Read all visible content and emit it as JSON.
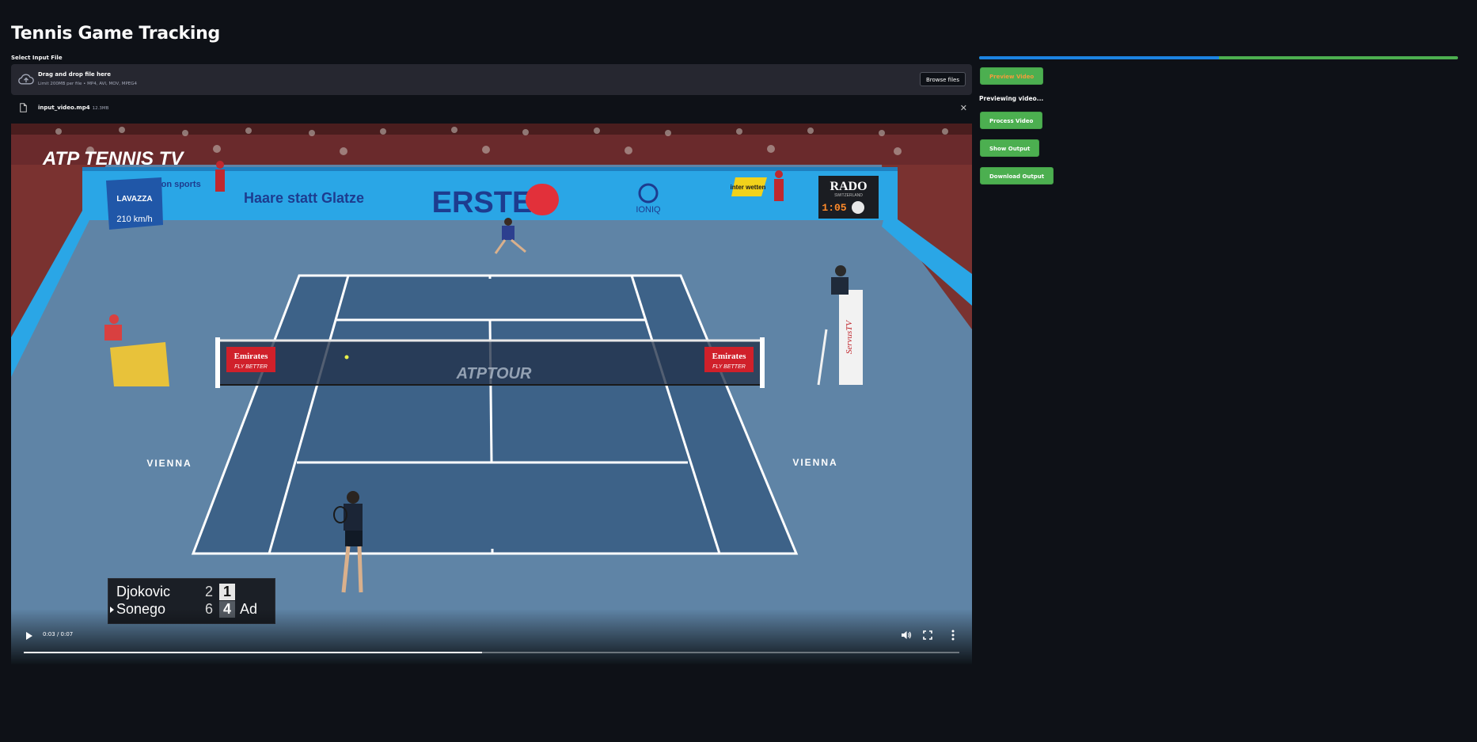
{
  "app": {
    "title": "Tennis Game Tracking"
  },
  "uploader": {
    "label": "Select Input File",
    "drop_text": "Drag and drop file here",
    "limit_text": "Limit 200MB per file • MP4, AVI, MOV, MPEG4",
    "browse_label": "Browse files",
    "file_name": "input_video.mp4",
    "file_size": "12.3MB",
    "close_glyph": "✕"
  },
  "video": {
    "time_display": "0:03 / 0:07",
    "played_fraction": 0.49,
    "overlay": {
      "broadcaster": "ATP TENNIS TV",
      "main_sponsor": "ERSTE",
      "sponsor_haare": "Haare statt Glatze",
      "sponsor_lavazza": "LAVAZZA",
      "lavazza_speed": "210 km/h",
      "sponsor_emotion": "emotion sports",
      "sponsor_ioniq": "IONIQ",
      "sponsor_interwetten": "inter wetten",
      "sponsor_rado": "RADO",
      "rado_sub": "SWITZERLAND",
      "clock": "1:05",
      "net_banner": "Emirates",
      "net_banner_sub": "FLY BETTER",
      "net_logo": "ATPTOUR",
      "city_left": "VIENNA",
      "city_right": "VIENNA",
      "umpire_board": "ServusTV"
    },
    "scoreboard": {
      "players": [
        {
          "name": "Djokovic",
          "set": "2",
          "game": "1",
          "points": ""
        },
        {
          "name": "Sonego",
          "set": "6",
          "game": "4",
          "points": "Ad"
        }
      ]
    },
    "colors": {
      "court": "#3d6288",
      "surround": "#5f84a6",
      "wall": "#2aa6e6"
    }
  },
  "sidebar": {
    "progress_fraction": 0.5,
    "colors": {
      "progress_fill": "#1c83e1",
      "progress_track": "#4caf50",
      "button": "#4caf50"
    },
    "preview_button": "Preview Video",
    "status_text": "Previewing video...",
    "process_button": "Process Video",
    "show_output_button": "Show Output",
    "download_button": "Download Output"
  }
}
